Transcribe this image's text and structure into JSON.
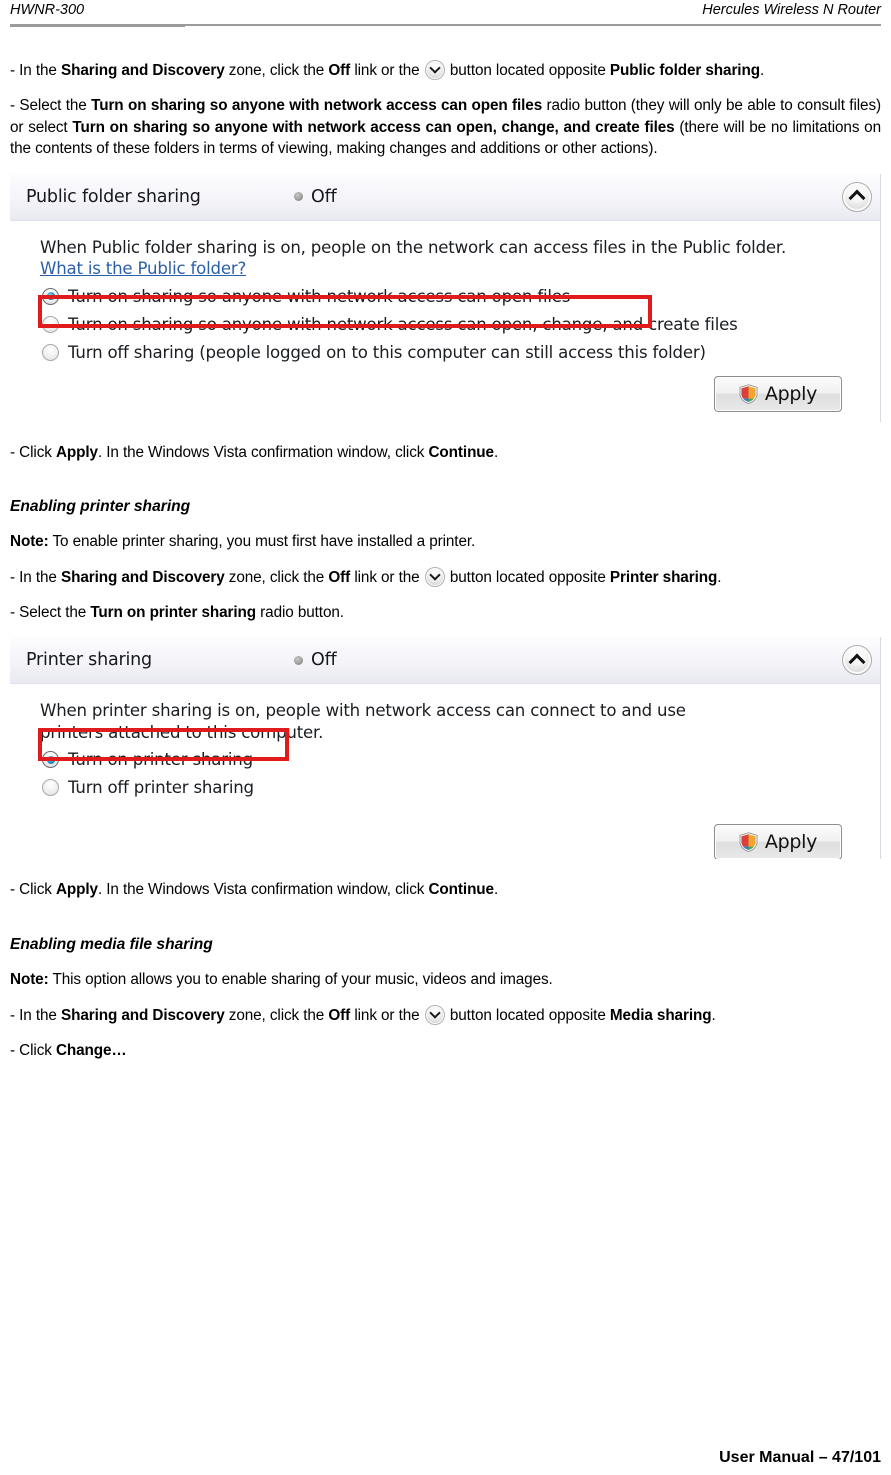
{
  "header": {
    "left": "HWNR-300",
    "right": "Hercules Wireless N Router"
  },
  "footer": {
    "text": "User Manual – 47/101"
  },
  "body": {
    "p1": {
      "seg1": "- In the ",
      "bold1": "Sharing and Discovery",
      "seg2": " zone, click the ",
      "bold2": "Off",
      "seg3": " link or the ",
      "seg4": " button located opposite ",
      "bold3": "Public folder sharing",
      "seg5": "."
    },
    "p2": {
      "seg1": "- Select the ",
      "bold1": "Turn on sharing so anyone with network access can open files",
      "seg2": " radio button (they will only be able to consult files) or select ",
      "bold2": "Turn on sharing so anyone with network access can open, change, and create files",
      "seg3": " (there will be no limitations on the contents of these folders in terms of viewing, making changes and additions or other actions)."
    },
    "p3": {
      "seg1": "- Click ",
      "bold1": "Apply",
      "seg2": ".  In the Windows Vista confirmation window, click ",
      "bold2": "Continue",
      "seg3": "."
    },
    "head_printer": "Enabling printer sharing",
    "note_printer": {
      "bold1": "Note:",
      "seg1": " To enable printer sharing, you must first have installed a printer."
    },
    "p4": {
      "seg1": "- In the ",
      "bold1": "Sharing and Discovery",
      "seg2": " zone, click the ",
      "bold2": "Off",
      "seg3": " link or the ",
      "seg4": " button located opposite ",
      "bold3": "Printer sharing",
      "seg5": "."
    },
    "p5": {
      "seg1": "- Select the ",
      "bold1": "Turn on printer sharing",
      "seg2": " radio button."
    },
    "p6": {
      "seg1": "- Click ",
      "bold1": "Apply",
      "seg2": ".  In the Windows Vista confirmation window, click ",
      "bold2": "Continue",
      "seg3": "."
    },
    "head_media": "Enabling media file sharing",
    "note_media": {
      "bold1": "Note:",
      "seg1": " This option allows you to enable sharing of your music, videos and images."
    },
    "p7": {
      "seg1": "- In the ",
      "bold1": "Sharing and Discovery",
      "seg2": " zone, click the ",
      "bold2": "Off",
      "seg3": " link or the ",
      "seg4": " button located opposite ",
      "bold3": "Media sharing",
      "seg5": "."
    },
    "p8": {
      "seg1": "- Click ",
      "bold1": "Change…"
    }
  },
  "screenshot_public": {
    "title": "Public folder sharing",
    "state": "Off",
    "collapse_icon": "chevron-up-icon",
    "description": "When Public folder sharing is on, people on the network can access files in the Public folder.",
    "link": "What is the Public folder?",
    "options": [
      {
        "label": "Turn on sharing so anyone with network access can open files",
        "checked": true,
        "highlighted": true
      },
      {
        "label": "Turn on sharing so anyone with network access can open, change, and create files",
        "checked": false,
        "highlighted": false
      },
      {
        "label": "Turn off sharing (people logged on to this computer can still access this folder)",
        "checked": false,
        "highlighted": false
      }
    ],
    "apply_label": "Apply",
    "apply_icon": "uac-shield-icon"
  },
  "screenshot_printer": {
    "title": "Printer sharing",
    "state": "Off",
    "collapse_icon": "chevron-up-icon",
    "description": "When printer sharing is on, people with network access can connect to and use printers attached to this computer.",
    "options": [
      {
        "label": "Turn on printer sharing",
        "checked": true,
        "highlighted": true
      },
      {
        "label": "Turn off printer sharing",
        "checked": false,
        "highlighted": false
      }
    ],
    "apply_label": "Apply",
    "apply_icon": "uac-shield-icon"
  },
  "colors": {
    "annotation_red": "#e01b1b",
    "link_blue": "#2b5faa",
    "radio_selected": "#1a8fc4",
    "rule_gray": "#9a9a9a"
  }
}
